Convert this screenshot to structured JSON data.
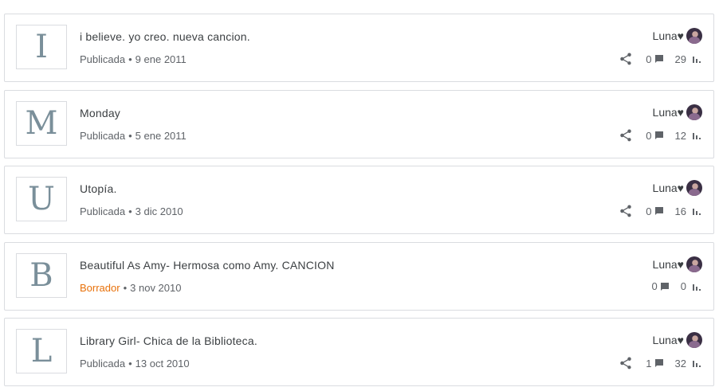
{
  "posts": [
    {
      "initial": "I",
      "title": "i believe. yo creo. nueva cancion.",
      "status": "Publicada",
      "status_type": "published",
      "date": "9 ene 2011",
      "author": "Luna♥",
      "comments": "0",
      "views": "29",
      "shareable": true
    },
    {
      "initial": "M",
      "title": "Monday",
      "status": "Publicada",
      "status_type": "published",
      "date": "5 ene 2011",
      "author": "Luna♥",
      "comments": "0",
      "views": "12",
      "shareable": true
    },
    {
      "initial": "U",
      "title": "Utopía.",
      "status": "Publicada",
      "status_type": "published",
      "date": "3 dic 2010",
      "author": "Luna♥",
      "comments": "0",
      "views": "16",
      "shareable": true
    },
    {
      "initial": "B",
      "title": "Beautiful As Amy- Hermosa como Amy. CANCION",
      "status": "Borrador",
      "status_type": "draft",
      "date": "3 nov 2010",
      "author": "Luna♥",
      "comments": "0",
      "views": "0",
      "shareable": false
    },
    {
      "initial": "L",
      "title": "Library Girl- Chica de la Biblioteca.",
      "status": "Publicada",
      "status_type": "published",
      "date": "13 oct 2010",
      "author": "Luna♥",
      "comments": "1",
      "views": "32",
      "shareable": true
    }
  ],
  "separator": "•",
  "colors": {
    "draft": "#e8710a",
    "icon": "#5f6368",
    "border": "#dadce0",
    "thumb_letter": "#7a8f9a"
  }
}
